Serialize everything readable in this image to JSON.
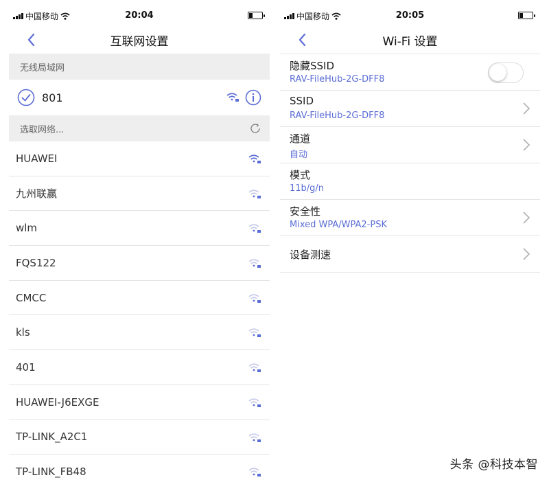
{
  "colors": {
    "accent": "#5b6dd6",
    "section_bg": "#eeeeee"
  },
  "left": {
    "status": {
      "carrier": "中国移动",
      "time": "20:04"
    },
    "title": "互联网设置",
    "wlan_header": "无线局域网",
    "connected": {
      "name": "801",
      "icons": [
        "checkmark-circle-icon",
        "wifi-lock-icon",
        "info-icon"
      ]
    },
    "choose_header": "选取网络...",
    "networks": [
      {
        "name": "HUAWEI"
      },
      {
        "name": "九州联赢"
      },
      {
        "name": "wlm"
      },
      {
        "name": "FQS122"
      },
      {
        "name": "CMCC"
      },
      {
        "name": "kls"
      },
      {
        "name": "401"
      },
      {
        "name": "HUAWEI-J6EXGE"
      },
      {
        "name": "TP-LINK_A2C1"
      },
      {
        "name": "TP-LINK_FB48"
      }
    ]
  },
  "right": {
    "status": {
      "carrier": "中国移动",
      "time": "20:05"
    },
    "title": "Wi-Fi 设置",
    "rows": [
      {
        "label": "隐藏SSID",
        "value": "RAV-FileHub-2G-DFF8",
        "toggle": "off"
      },
      {
        "label": "SSID",
        "value": "RAV-FileHub-2G-DFF8",
        "chevron": true
      },
      {
        "label": "通道",
        "value": "自动",
        "chevron": true
      },
      {
        "label": "模式",
        "value": "11b/g/n",
        "chevron": false
      },
      {
        "label": "安全性",
        "value": "Mixed WPA/WPA2-PSK",
        "chevron": true
      },
      {
        "label": "设备测速",
        "chevron": true
      }
    ]
  },
  "watermark": "头条 @科技本智"
}
